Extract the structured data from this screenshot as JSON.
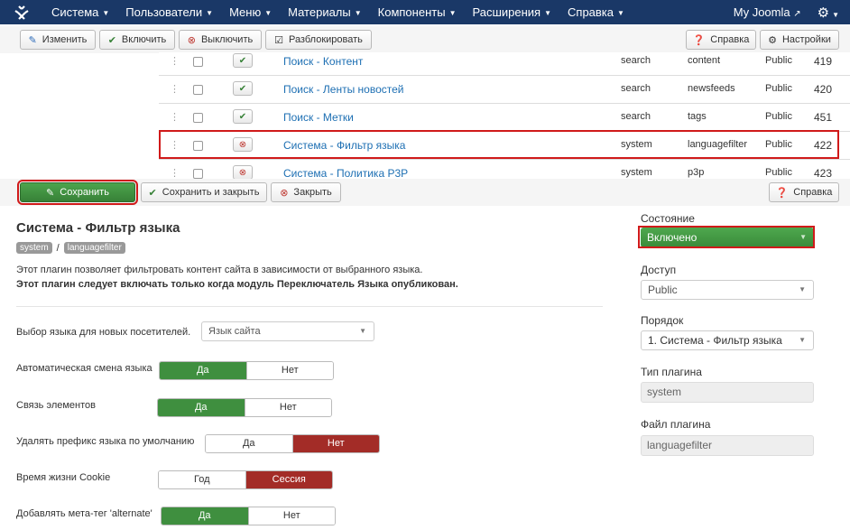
{
  "navbar": {
    "menu": [
      "Система",
      "Пользователи",
      "Меню",
      "Материалы",
      "Компоненты",
      "Расширения",
      "Справка"
    ],
    "site_link": "My Joomla"
  },
  "list_toolbar": {
    "edit": "Изменить",
    "enable": "Включить",
    "disable": "Выключить",
    "unlock": "Разблокировать",
    "help": "Справка",
    "options": "Настройки"
  },
  "plugins": [
    {
      "name": "Поиск - Контент",
      "type": "search",
      "element": "content",
      "access": "Public",
      "id": "419",
      "enabled": true
    },
    {
      "name": "Поиск - Ленты новостей",
      "type": "search",
      "element": "newsfeeds",
      "access": "Public",
      "id": "420",
      "enabled": true
    },
    {
      "name": "Поиск - Метки",
      "type": "search",
      "element": "tags",
      "access": "Public",
      "id": "451",
      "enabled": true
    },
    {
      "name": "Система - Фильтр языка",
      "type": "system",
      "element": "languagefilter",
      "access": "Public",
      "id": "422",
      "enabled": false
    },
    {
      "name": "Система - Политика P3P",
      "type": "system",
      "element": "p3p",
      "access": "Public",
      "id": "423",
      "enabled": false
    }
  ],
  "edit_toolbar": {
    "save": "Сохранить",
    "save_close": "Сохранить и закрыть",
    "close": "Закрыть",
    "help": "Справка"
  },
  "plugin": {
    "title": "Система - Фильтр языка",
    "tag_folder": "system",
    "tag_sep": "/",
    "tag_element": "languagefilter",
    "desc1": "Этот плагин позволяет фильтровать контент сайта в зависимости от выбранного языка.",
    "desc2": "Этот плагин следует включать только когда модуль Переключатель Языка опубликован."
  },
  "fields": {
    "new_visitor_label": "Выбор языка для новых посетителей.",
    "new_visitor_value": "Язык сайта",
    "auto_switch": {
      "label": "Автоматическая смена языка",
      "a": "Да",
      "b": "Нет"
    },
    "item_assoc": {
      "label": "Связь элементов",
      "a": "Да",
      "b": "Нет"
    },
    "remove_prefix": {
      "label": "Удалять префикс языка по умолчанию",
      "a": "Да",
      "b": "Нет"
    },
    "cookie": {
      "label": "Время жизни Cookie",
      "a": "Год",
      "b": "Сессия"
    },
    "alternate": {
      "label": "Добавлять мета-тег 'alternate'",
      "a": "Да",
      "b": "Нет"
    }
  },
  "sidebar": {
    "status_label": "Состояние",
    "status_value": "Включено",
    "access_label": "Доступ",
    "access_value": "Public",
    "order_label": "Порядок",
    "order_value": "1. Система - Фильтр языка",
    "type_label": "Тип плагина",
    "type_value": "system",
    "file_label": "Файл плагина",
    "file_value": "languagefilter"
  }
}
